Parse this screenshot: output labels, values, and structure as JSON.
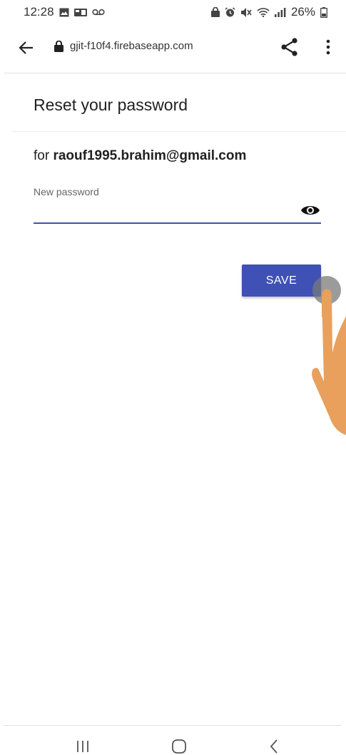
{
  "status_bar": {
    "time": "12:28",
    "battery_percent": "26%",
    "left_icons": [
      "gallery-icon",
      "sim-icon",
      "voicemail-icon"
    ],
    "right_icons": [
      "lock-icon",
      "alarm-icon",
      "mute-icon",
      "wifi-icon",
      "signal-icon",
      "battery-icon"
    ]
  },
  "browser": {
    "url": "gjit-f10f4.firebaseapp.com",
    "lock_icon": "lock-icon",
    "back_icon": "arrow-left-icon",
    "share_icon": "share-icon",
    "menu_icon": "more-vert-icon"
  },
  "form": {
    "title": "Reset your password",
    "for_prefix": "for",
    "email": "raouf1995.brahim@gmail.com",
    "password_label": "New password",
    "password_value": "",
    "visibility_icon": "eye-icon",
    "save_label": "SAVE"
  },
  "nav": {
    "recent_icon": "recent-apps-icon",
    "home_icon": "home-icon",
    "back_icon": "back-chevron-icon"
  },
  "colors": {
    "primary": "#3f51b5",
    "hand": "#e8a05c"
  }
}
